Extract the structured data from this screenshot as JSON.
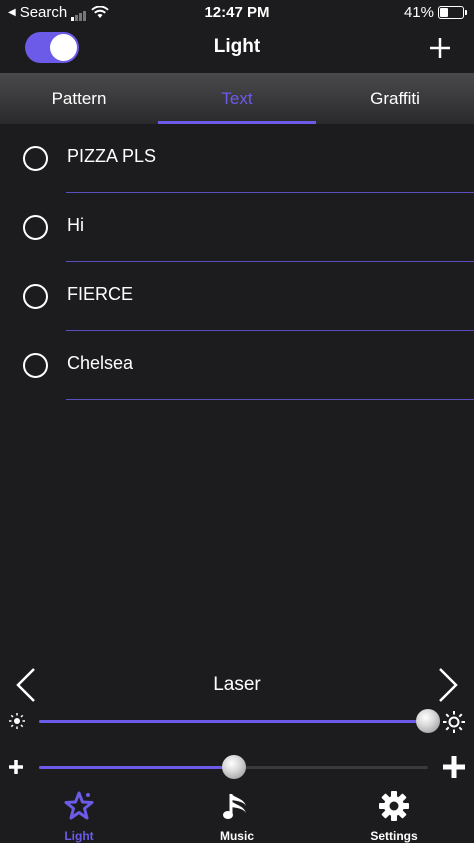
{
  "status_bar": {
    "back_label": "Search",
    "time": "12:47 PM",
    "battery_percent": "41%",
    "battery_level": 0.41
  },
  "nav": {
    "title": "Light",
    "toggle_on": true
  },
  "tabs": [
    {
      "label": "Pattern",
      "active": false
    },
    {
      "label": "Text",
      "active": true
    },
    {
      "label": "Graffiti",
      "active": false
    }
  ],
  "list": {
    "items": [
      {
        "label": "PIZZA PLS"
      },
      {
        "label": "Hi"
      },
      {
        "label": "FIERCE"
      },
      {
        "label": "Chelsea"
      }
    ]
  },
  "mode": {
    "label": "Laser"
  },
  "sliders": {
    "brightness": {
      "value": 1.0
    },
    "size": {
      "value": 0.5
    }
  },
  "tab_bar": {
    "items": [
      {
        "label": "Light",
        "icon": "star-icon",
        "active": true
      },
      {
        "label": "Music",
        "icon": "music-note-icon",
        "active": false
      },
      {
        "label": "Settings",
        "icon": "gear-icon",
        "active": false
      }
    ]
  },
  "colors": {
    "accent": "#6b5be8",
    "background": "#1c1c1e"
  }
}
